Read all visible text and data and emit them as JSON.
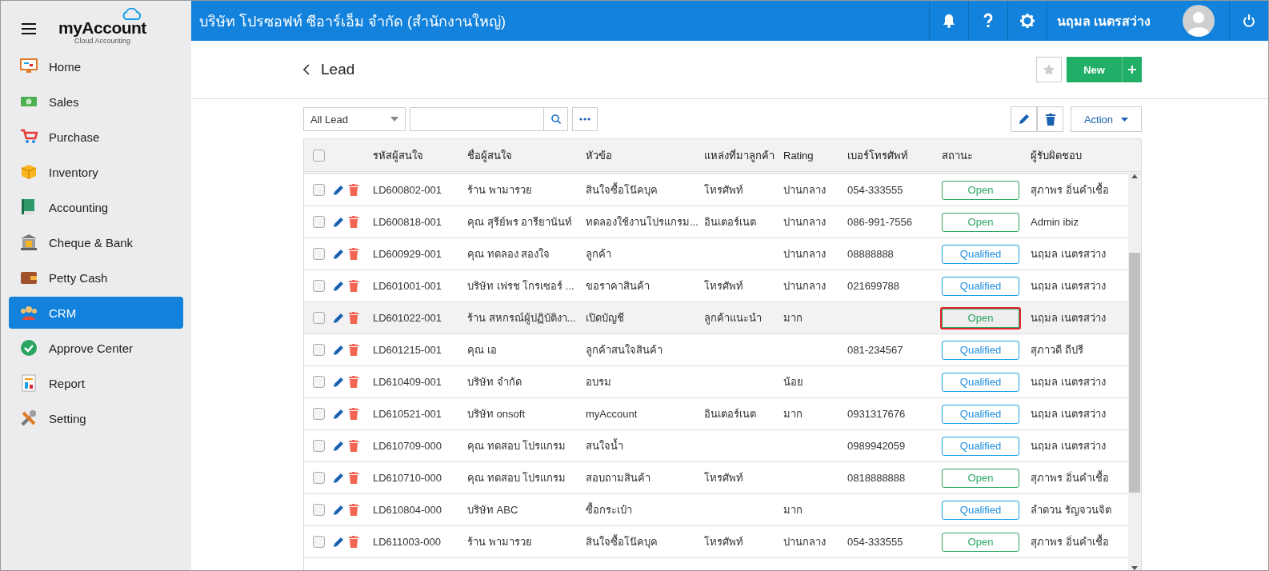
{
  "header": {
    "company": "บริษัท โปรซอฟท์ ซีอาร์เอ็ม จำกัด (สำนักงานใหญ่)",
    "user": "นฤมล เนตรสว่าง"
  },
  "sidebar": {
    "logo": "myAccount",
    "logo_sub": "Cloud Accounting",
    "items": [
      {
        "label": "Home",
        "selected": false
      },
      {
        "label": "Sales",
        "selected": false
      },
      {
        "label": "Purchase",
        "selected": false
      },
      {
        "label": "Inventory",
        "selected": false
      },
      {
        "label": "Accounting",
        "selected": false
      },
      {
        "label": "Cheque & Bank",
        "selected": false
      },
      {
        "label": "Petty Cash",
        "selected": false
      },
      {
        "label": "CRM",
        "selected": true
      },
      {
        "label": "Approve Center",
        "selected": false
      },
      {
        "label": "Report",
        "selected": false
      },
      {
        "label": "Setting",
        "selected": false
      }
    ]
  },
  "page": {
    "title": "Lead",
    "new_button": "New"
  },
  "toolbar": {
    "filter": "All Lead",
    "action": "Action"
  },
  "table": {
    "all_checked": false,
    "columns": [
      "รหัสผู้สนใจ",
      "ชื่อผู้สนใจ",
      "หัวข้อ",
      "แหล่งที่มาลูกค้า",
      "Rating",
      "เบอร์โทรศัพท์",
      "สถานะ",
      "ผู้รับผิดชอบ"
    ],
    "rows": [
      {
        "checked": false,
        "selected": false,
        "code": "LD600802-001",
        "name": "ร้าน พามารวย",
        "subject": "สินใจซื้อโน๊คบุค",
        "source": "โทรศัพท์",
        "rating": "ปานกลาง",
        "phone": "054-333555",
        "status": {
          "label": "Open",
          "kind": "open"
        },
        "highlighted": false,
        "owner": "สุภาพร อิ่นคำเชื้อ"
      },
      {
        "checked": false,
        "selected": false,
        "code": "LD600818-001",
        "name": "คุณ สุรีย์พร อารียานันท์",
        "subject": "ทดลองใช้งานโปรแกรม...",
        "source": "อินเตอร์เนต",
        "rating": "ปานกลาง",
        "phone": "086-991-7556",
        "status": {
          "label": "Open",
          "kind": "open"
        },
        "highlighted": false,
        "owner": "Admin ibiz"
      },
      {
        "checked": false,
        "selected": false,
        "code": "LD600929-001",
        "name": "คุณ ทดลอง สองใจ",
        "subject": "ลูกค้า",
        "rating": "ปานกลาง",
        "phone": "08888888",
        "status": {
          "label": "Qualified",
          "kind": "qualified"
        },
        "highlighted": false,
        "owner": "นฤมล เนตรสว่าง"
      },
      {
        "checked": false,
        "selected": false,
        "code": "LD601001-001",
        "name": "บริษัท เฟรช โกรเซอร์ ...",
        "subject": "ขอราคาสินค้า",
        "source": "โทรศัพท์",
        "rating": "ปานกลาง",
        "phone": "021699788",
        "status": {
          "label": "Qualified",
          "kind": "qualified"
        },
        "highlighted": false,
        "owner": "นฤมล เนตรสว่าง"
      },
      {
        "checked": false,
        "selected": true,
        "code": "LD601022-001",
        "name": "ร้าน สหกรณ์ผู้ปฏิบัติงา...",
        "subject": "เปิดบัญชี",
        "source": "ลูกค้าแนะนำ",
        "rating": "มาก",
        "status": {
          "label": "Open",
          "kind": "open"
        },
        "highlighted": true,
        "owner": "นฤมล เนตรสว่าง"
      },
      {
        "checked": false,
        "selected": false,
        "code": "LD601215-001",
        "name": "คุณ เอ",
        "subject": "ลูกค้าสนใจสินค้า",
        "phone": "081-234567",
        "status": {
          "label": "Qualified",
          "kind": "qualified"
        },
        "highlighted": false,
        "owner": "สุภาวดี ถีปรี"
      },
      {
        "checked": false,
        "selected": false,
        "code": "LD610409-001",
        "name": "บริษัท จำกัด",
        "subject": "อบรม",
        "rating": "น้อย",
        "status": {
          "label": "Qualified",
          "kind": "qualified"
        },
        "highlighted": false,
        "owner": "นฤมล เนตรสว่าง"
      },
      {
        "checked": false,
        "selected": false,
        "code": "LD610521-001",
        "name": "บริษัท onsoft",
        "subject": "myAccount",
        "source": "อินเตอร์เนต",
        "rating": "มาก",
        "phone": "0931317676",
        "status": {
          "label": "Qualified",
          "kind": "qualified"
        },
        "highlighted": false,
        "owner": "นฤมล เนตรสว่าง"
      },
      {
        "checked": false,
        "selected": false,
        "code": "LD610709-000",
        "name": "คุณ ทดสอบ โปรแกรม",
        "subject": "สนใจน้ำ",
        "phone": "0989942059",
        "status": {
          "label": "Qualified",
          "kind": "qualified"
        },
        "highlighted": false,
        "owner": "นฤมล เนตรสว่าง"
      },
      {
        "checked": false,
        "selected": false,
        "code": "LD610710-000",
        "name": "คุณ ทดสอบ โปรแกรม",
        "subject": "สอบถามสินค้า",
        "source": "โทรศัพท์",
        "phone": "0818888888",
        "status": {
          "label": "Open",
          "kind": "open"
        },
        "highlighted": false,
        "owner": "สุภาพร อิ่นคำเชื้อ"
      },
      {
        "checked": false,
        "selected": false,
        "code": "LD610804-000",
        "name": "บริษัท ABC",
        "subject": "ซื้อกระเป๋า",
        "rating": "มาก",
        "status": {
          "label": "Qualified",
          "kind": "qualified"
        },
        "highlighted": false,
        "owner": "ลำดวน รัญจวนจิต"
      },
      {
        "checked": false,
        "selected": false,
        "code": "LD611003-000",
        "name": "ร้าน พามารวย",
        "subject": "สินใจซื้อโน๊คบุค",
        "source": "โทรศัพท์",
        "rating": "ปานกลาง",
        "phone": "054-333555",
        "status": {
          "label": "Open",
          "kind": "open"
        },
        "highlighted": false,
        "owner": "สุภาพร อิ่นคำเชื้อ"
      }
    ]
  }
}
